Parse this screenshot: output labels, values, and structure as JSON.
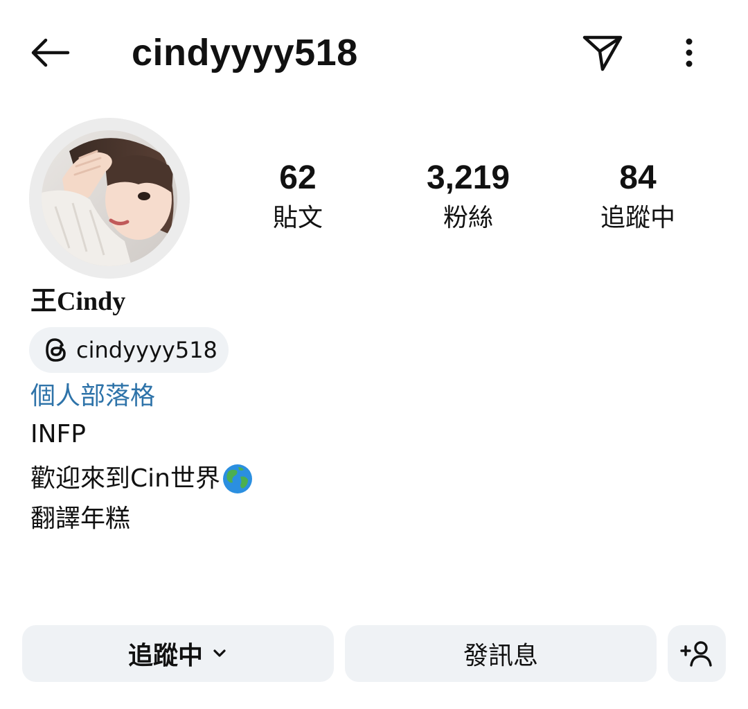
{
  "header": {
    "username": "cindyyyy518",
    "back_icon": "arrow-left-icon",
    "send_icon": "paper-plane-icon",
    "more_icon": "more-vertical-icon"
  },
  "profile": {
    "avatar_icon": "profile-photo",
    "display_name": "王Cindy",
    "stats": [
      {
        "value": "62",
        "label": "貼文"
      },
      {
        "value": "3,219",
        "label": "粉絲"
      },
      {
        "value": "84",
        "label": "追蹤中"
      }
    ],
    "threads_handle": "cindyyyy518",
    "threads_icon": "threads-icon",
    "bio_link": "個人部落格",
    "bio_lines": [
      "INFP",
      "歡迎來到Cin世界",
      "翻譯年糕"
    ],
    "bio_emoji_icon": "globe-emoji-icon"
  },
  "actions": {
    "following_label": "追蹤中",
    "message_label": "發訊息",
    "add_user_icon": "add-user-icon"
  },
  "colors": {
    "link": "#2e73a9",
    "button_bg": "#eff2f5",
    "text": "#111111"
  }
}
